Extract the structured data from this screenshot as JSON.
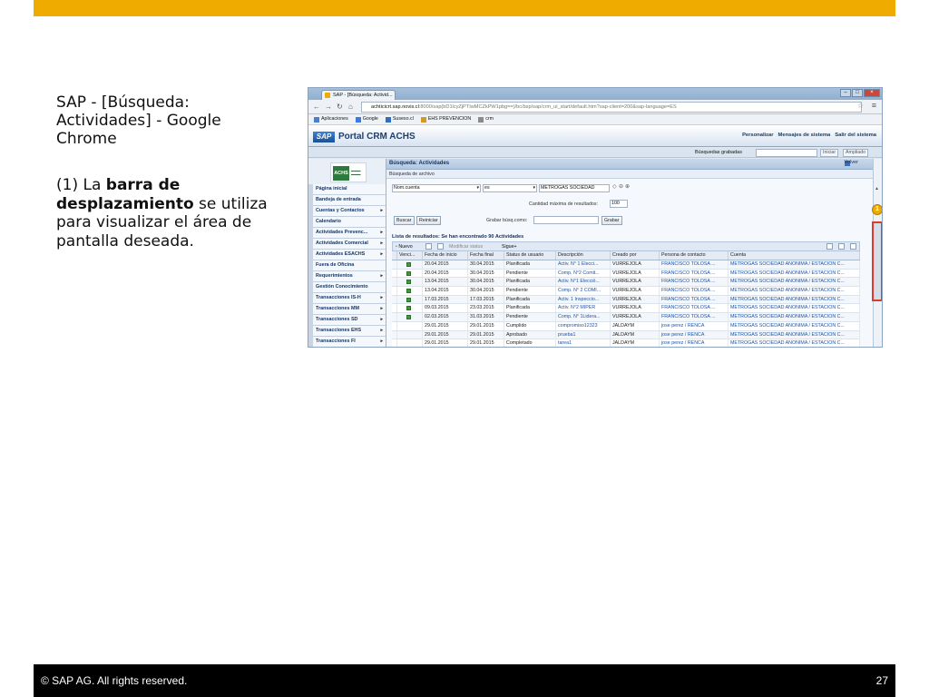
{
  "slide": {
    "title": "SAP - [Búsqueda: Actividades] - Google Chrome",
    "desc_prefix": "(1) La ",
    "desc_bold": "barra de desplazamiento",
    "desc_suffix": " se utiliza para visualizar el área de pantalla deseada.",
    "footer_copyright": "©  SAP AG. All rights reserved.",
    "page_number": "27",
    "accent_color": "#f0ab00"
  },
  "browser": {
    "tab_title": "SAP - [Búsqueda: Activid...",
    "url_host": "achticicrt.sap.novis.cl",
    "url_rest": ":8000/sap(bD1lcyZjPTIwMCZkPW1pbg==)/bc/bsp/sap/crm_ui_start/default.htm?sap-client=200&sap-language=ES",
    "bookmarks": [
      "Aplicaciones",
      "Google",
      "Suseso.cl",
      "EHS PREVENCION",
      "crm"
    ]
  },
  "portal": {
    "logo": "SAP",
    "title": "Portal CRM ACHS",
    "links": [
      "Personalizar",
      "Mensajes de sistema",
      "Salir del sistema"
    ],
    "saved_searches_label": "Búsquedas grabadas",
    "btn_start": "Iniciar",
    "btn_extended": "Ampliado",
    "achs_logo": "ACHS"
  },
  "sidebar": {
    "items": [
      {
        "label": "Página inicial",
        "arrow": ""
      },
      {
        "label": "Bandeja de entrada",
        "arrow": ""
      },
      {
        "label": "Cuentas y Contactos",
        "arrow": "▸"
      },
      {
        "label": "Calendario",
        "arrow": ""
      },
      {
        "label": "Actividades Prevenc...",
        "arrow": "▸"
      },
      {
        "label": "Actividades Comercial",
        "arrow": "▸"
      },
      {
        "label": "Actividades ESACHS",
        "arrow": "▸"
      },
      {
        "label": "Fuera de Oficina",
        "arrow": ""
      },
      {
        "label": "Requerimientos",
        "arrow": "▸"
      },
      {
        "label": "Gestión Conocimiento",
        "arrow": ""
      },
      {
        "label": "Transacciones IS-H",
        "arrow": "▸"
      },
      {
        "label": "Transacciones MM",
        "arrow": "▸"
      },
      {
        "label": "Transacciones SD",
        "arrow": "▸"
      },
      {
        "label": "Transacciones EHS",
        "arrow": "▸"
      },
      {
        "label": "Transacciones FI",
        "arrow": "▸"
      }
    ]
  },
  "search": {
    "page_title": "Búsqueda: Actividades",
    "back_label": "Volver",
    "archive_label": "Búsqueda de archivo",
    "field_name": "Nom.cuenta",
    "field_operator": "es",
    "field_value": "METROGAS SOCIEDAD",
    "max_results_label": "Cantidad máxima de resultados:",
    "max_results_value": "100",
    "btn_search": "Buscar",
    "btn_reset": "Reiniciar",
    "save_search_label": "Grabar búsq.como:",
    "btn_save": "Grabar"
  },
  "results": {
    "title": "Lista de resultados: Se han encontrado 90 Actividades",
    "btn_new": "Nuevo",
    "btn_modify_status": "Modificar status",
    "btn_next": "Sigue+",
    "columns": [
      "Venci...",
      "Fecha de inicio",
      "Fecha final",
      "Status de usuario",
      "Descripción",
      "Creado por",
      "Persona de contacto",
      "Cuenta"
    ],
    "rows": [
      {
        "status": true,
        "start": "20.04.2015",
        "end": "30.04.2015",
        "user_status": "Planificada",
        "desc": "Activ. N° 1 Elecci...",
        "creator": "VURREJOLA",
        "contact": "FRANCISCO TOLOSA ...",
        "account": "METROGAS SOCIEDAD ANONIMA / ESTACION C..."
      },
      {
        "status": true,
        "start": "20.04.2015",
        "end": "30.04.2015",
        "user_status": "Pendiente",
        "desc": "Comp. N°2 Comit...",
        "creator": "VURREJOLA",
        "contact": "FRANCISCO TOLOSA ...",
        "account": "METROGAS SOCIEDAD ANONIMA / ESTACION C..."
      },
      {
        "status": true,
        "start": "13.04.2015",
        "end": "30.04.2015",
        "user_status": "Planificada",
        "desc": "Activ. N°1 Elecció...",
        "creator": "VURREJOLA",
        "contact": "FRANCISCO TOLOSA ...",
        "account": "METROGAS SOCIEDAD ANONIMA / ESTACION C..."
      },
      {
        "status": true,
        "start": "13.04.2015",
        "end": "30.04.2015",
        "user_status": "Pendiente",
        "desc": "Comp. N° 2 COMI...",
        "creator": "VURREJOLA",
        "contact": "FRANCISCO TOLOSA ...",
        "account": "METROGAS SOCIEDAD ANONIMA / ESTACION C..."
      },
      {
        "status": true,
        "start": "17.03.2015",
        "end": "17.03.2015",
        "user_status": "Planificada",
        "desc": "Activ. 1 Inspeccio...",
        "creator": "VURREJOLA",
        "contact": "FRANCISCO TOLOSA ...",
        "account": "METROGAS SOCIEDAD ANONIMA / ESTACION C..."
      },
      {
        "status": true,
        "start": "09.03.2015",
        "end": "23.03.2015",
        "user_status": "Planificada",
        "desc": "Activ. N°2 MIPER",
        "creator": "VURREJOLA",
        "contact": "FRANCISCO TOLOSA ...",
        "account": "METROGAS SOCIEDAD ANONIMA / ESTACION C..."
      },
      {
        "status": true,
        "start": "02.03.2015",
        "end": "31.03.2015",
        "user_status": "Pendiente",
        "desc": "Comp. N° 1Lidera...",
        "creator": "VURREJOLA",
        "contact": "FRANCISCO TOLOSA ...",
        "account": "METROGAS SOCIEDAD ANONIMA / ESTACION C..."
      },
      {
        "status": false,
        "start": "29.01.2015",
        "end": "29.01.2015",
        "user_status": "Cumplido",
        "desc": "compromiso12323",
        "creator": "JALDAYM",
        "contact": "jose perez / RENCA",
        "account": "METROGAS SOCIEDAD ANONIMA / ESTACION C..."
      },
      {
        "status": false,
        "start": "29.01.2015",
        "end": "29.01.2015",
        "user_status": "Aprobado",
        "desc": "prueba1",
        "creator": "JALDAYM",
        "contact": "jose perez / RENCA",
        "account": "METROGAS SOCIEDAD ANONIMA / ESTACION C..."
      },
      {
        "status": false,
        "start": "29.01.2015",
        "end": "29.01.2015",
        "user_status": "Completado",
        "desc": "tarea1",
        "creator": "JALDAYM",
        "contact": "jose perez / RENCA",
        "account": "METROGAS SOCIEDAD ANONIMA / ESTACION C..."
      }
    ]
  },
  "callout_number": "1"
}
